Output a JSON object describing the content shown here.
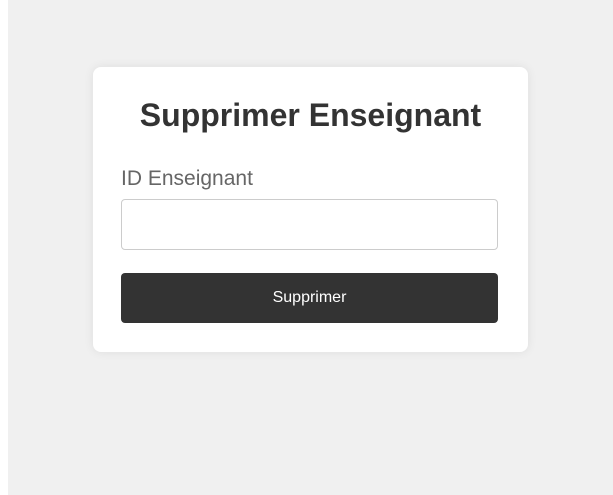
{
  "form": {
    "title": "Supprimer Enseignant",
    "id_label": "ID Enseignant",
    "id_value": "",
    "submit_label": "Supprimer"
  },
  "colors": {
    "background": "#f0f0f0",
    "card": "#ffffff",
    "button": "#333333",
    "title_text": "#333333",
    "label_text": "#666666"
  }
}
